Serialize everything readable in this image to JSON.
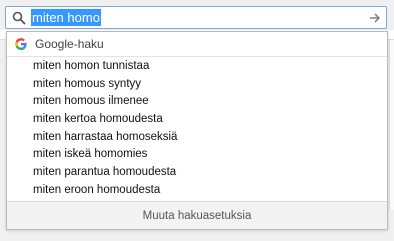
{
  "search": {
    "query": "miten homo"
  },
  "engine": {
    "name": "Google-haku",
    "icon": "google-g-icon"
  },
  "suggestions": [
    "miten homon tunnistaa",
    "miten homous syntyy",
    "miten homous ilmenee",
    "miten kertoa homoudesta",
    "miten harrastaa homoseksiä",
    "miten iskeä homomies",
    "miten parantua homoudesta",
    "miten eroon homoudesta"
  ],
  "footer": {
    "settings_label": "Muuta hakuasetuksia"
  },
  "colors": {
    "selection": "#3399ff",
    "focus_border": "#7fa7d6",
    "google_blue": "#4285f4",
    "google_red": "#ea4335",
    "google_yellow": "#fbbc05",
    "google_green": "#34a853"
  }
}
